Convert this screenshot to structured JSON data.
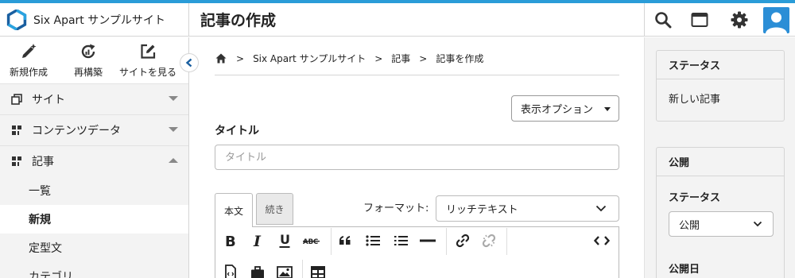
{
  "header": {
    "site_name": "Six Apart サンプルサイト",
    "page_title": "記事の作成",
    "icons": [
      "search-icon",
      "window-icon",
      "gear-icon",
      "user-avatar-icon"
    ]
  },
  "sidebar": {
    "quick_actions": [
      {
        "label": "新規作成",
        "icon": "pencil-sparkle-icon"
      },
      {
        "label": "再構築",
        "icon": "rebuild-icon"
      },
      {
        "label": "サイトを見る",
        "icon": "external-edit-icon"
      }
    ],
    "menu": [
      {
        "label": "サイト",
        "icon": "site-icon",
        "expanded": false
      },
      {
        "label": "コンテンツデータ",
        "icon": "content-data-icon",
        "expanded": false
      },
      {
        "label": "記事",
        "icon": "entry-icon",
        "expanded": true
      }
    ],
    "submenu": [
      {
        "label": "一覧",
        "active": false
      },
      {
        "label": "新規",
        "active": true
      },
      {
        "label": "定型文",
        "active": false
      },
      {
        "label": "カテゴリ",
        "active": false
      }
    ]
  },
  "breadcrumb": {
    "items": [
      "Six Apart サンプルサイト",
      "記事",
      "記事を作成"
    ],
    "separator": ">"
  },
  "editor": {
    "display_options": "表示オプション",
    "title_label": "タイトル",
    "title_placeholder": "タイトル",
    "title_value": "",
    "tabs": [
      "本文",
      "続き"
    ],
    "format_label": "フォーマット:",
    "format_value": "リッチテキスト",
    "toolbar_buttons": [
      "bold-icon",
      "italic-icon",
      "underline-icon",
      "strikethrough-icon",
      "blockquote-icon",
      "bullet-list-icon",
      "numbered-list-icon",
      "horizontal-rule-icon",
      "link-icon",
      "unlink-icon",
      "source-code-icon",
      "insert-file-icon",
      "insert-asset-icon",
      "insert-image-icon",
      "insert-table-icon"
    ]
  },
  "right": {
    "status_widget": {
      "title": "ステータス",
      "value": "新しい記事"
    },
    "publish_widget": {
      "title": "公開",
      "status_label": "ステータス",
      "status_value": "公開",
      "date_label": "公開日"
    }
  },
  "colors": {
    "accent": "#2a9cd8",
    "avatar": "#2b8ed6"
  }
}
